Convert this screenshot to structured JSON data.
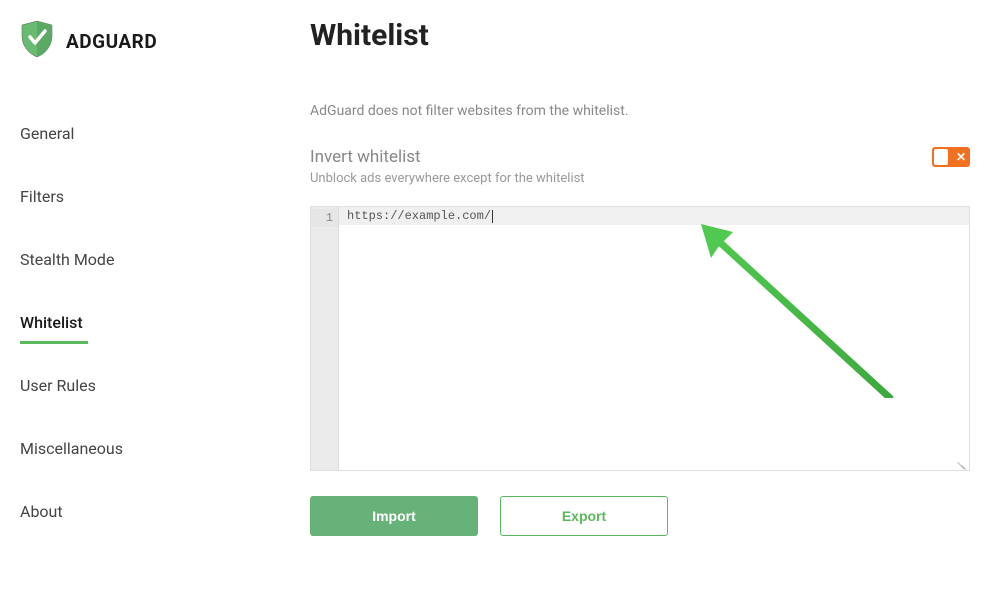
{
  "brand": {
    "name": "ADGUARD"
  },
  "sidebar": {
    "items": [
      {
        "label": "General"
      },
      {
        "label": "Filters"
      },
      {
        "label": "Stealth Mode"
      },
      {
        "label": "Whitelist"
      },
      {
        "label": "User Rules"
      },
      {
        "label": "Miscellaneous"
      },
      {
        "label": "About"
      }
    ]
  },
  "page": {
    "title": "Whitelist",
    "description": "AdGuard does not filter websites from the whitelist."
  },
  "setting": {
    "title": "Invert whitelist",
    "subtitle": "Unblock ads everywhere except for the whitelist",
    "toggle_state": "off",
    "toggle_icon": "✕"
  },
  "editor": {
    "line_number": "1",
    "content": "https://example.com/"
  },
  "buttons": {
    "import": "Import",
    "export": "Export"
  }
}
